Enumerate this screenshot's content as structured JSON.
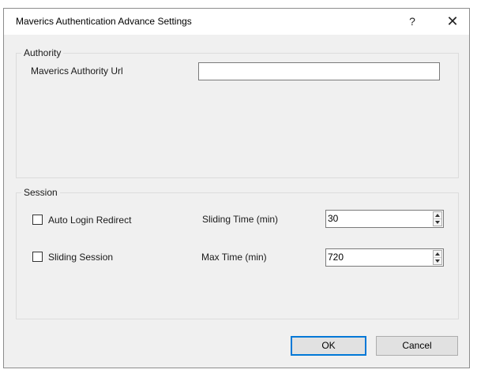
{
  "window": {
    "title": "Maverics Authentication Advance Settings",
    "help_glyph": "?",
    "close_glyph": "✕"
  },
  "authority": {
    "group_label": "Authority",
    "url_label": "Maverics Authority Url",
    "url_value": ""
  },
  "session": {
    "group_label": "Session",
    "auto_login_label": "Auto Login Redirect",
    "auto_login_checked": false,
    "sliding_session_label": "Sliding Session",
    "sliding_session_checked": false,
    "sliding_time_label": "Sliding Time (min)",
    "sliding_time_value": "30",
    "max_time_label": "Max Time (min)",
    "max_time_value": "720"
  },
  "buttons": {
    "ok_label": "OK",
    "cancel_label": "Cancel"
  },
  "colors": {
    "dialog_bg": "#f0f0f0",
    "default_button_border": "#0078d7"
  }
}
